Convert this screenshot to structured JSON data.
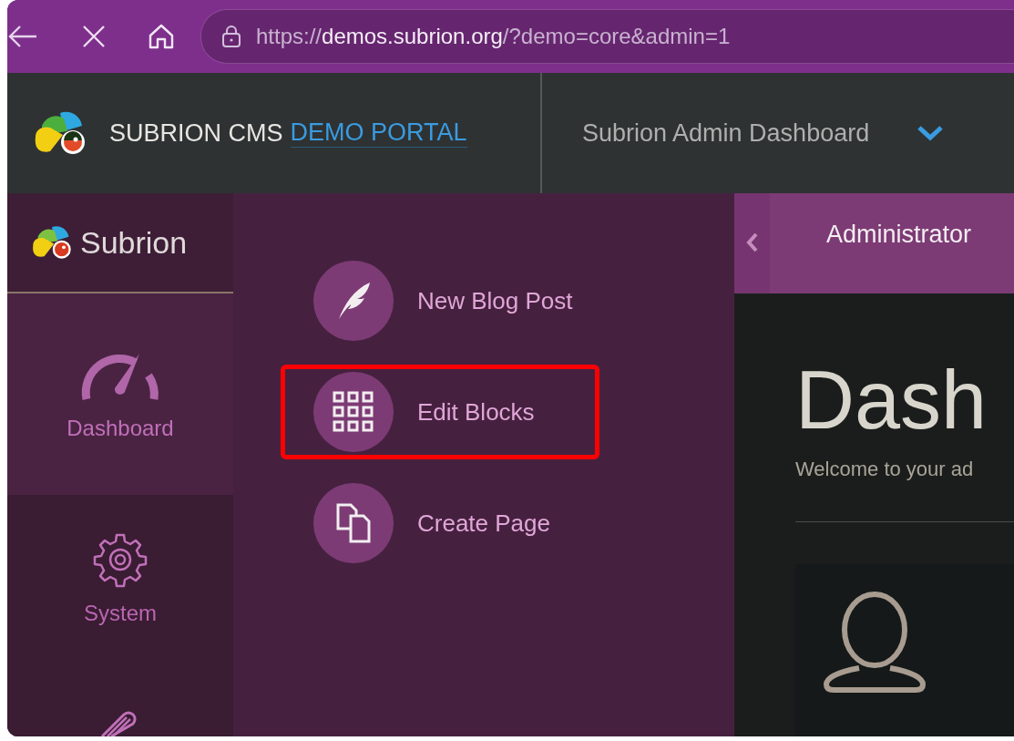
{
  "browser": {
    "url": "https://**demos.subrion.org**/?demo=core&admin=1"
  },
  "header": {
    "brand": "SUBRION CMS",
    "brand_link": "DEMO PORTAL",
    "site_menu": "Subrion Admin Dashboard"
  },
  "sidebar": {
    "logo_text": "Subrion",
    "items": [
      {
        "label": "Dashboard",
        "selected": true
      },
      {
        "label": "System",
        "selected": false
      },
      {
        "selected": false
      }
    ]
  },
  "submenu": {
    "items": [
      {
        "label": "New Blog Post",
        "highlighted": false
      },
      {
        "label": "Edit Blocks",
        "highlighted": true
      },
      {
        "label": "Create Page",
        "highlighted": false
      }
    ]
  },
  "content": {
    "user_tab": "Administrator",
    "title": "Dash",
    "subtitle": "Welcome to your ad"
  }
}
